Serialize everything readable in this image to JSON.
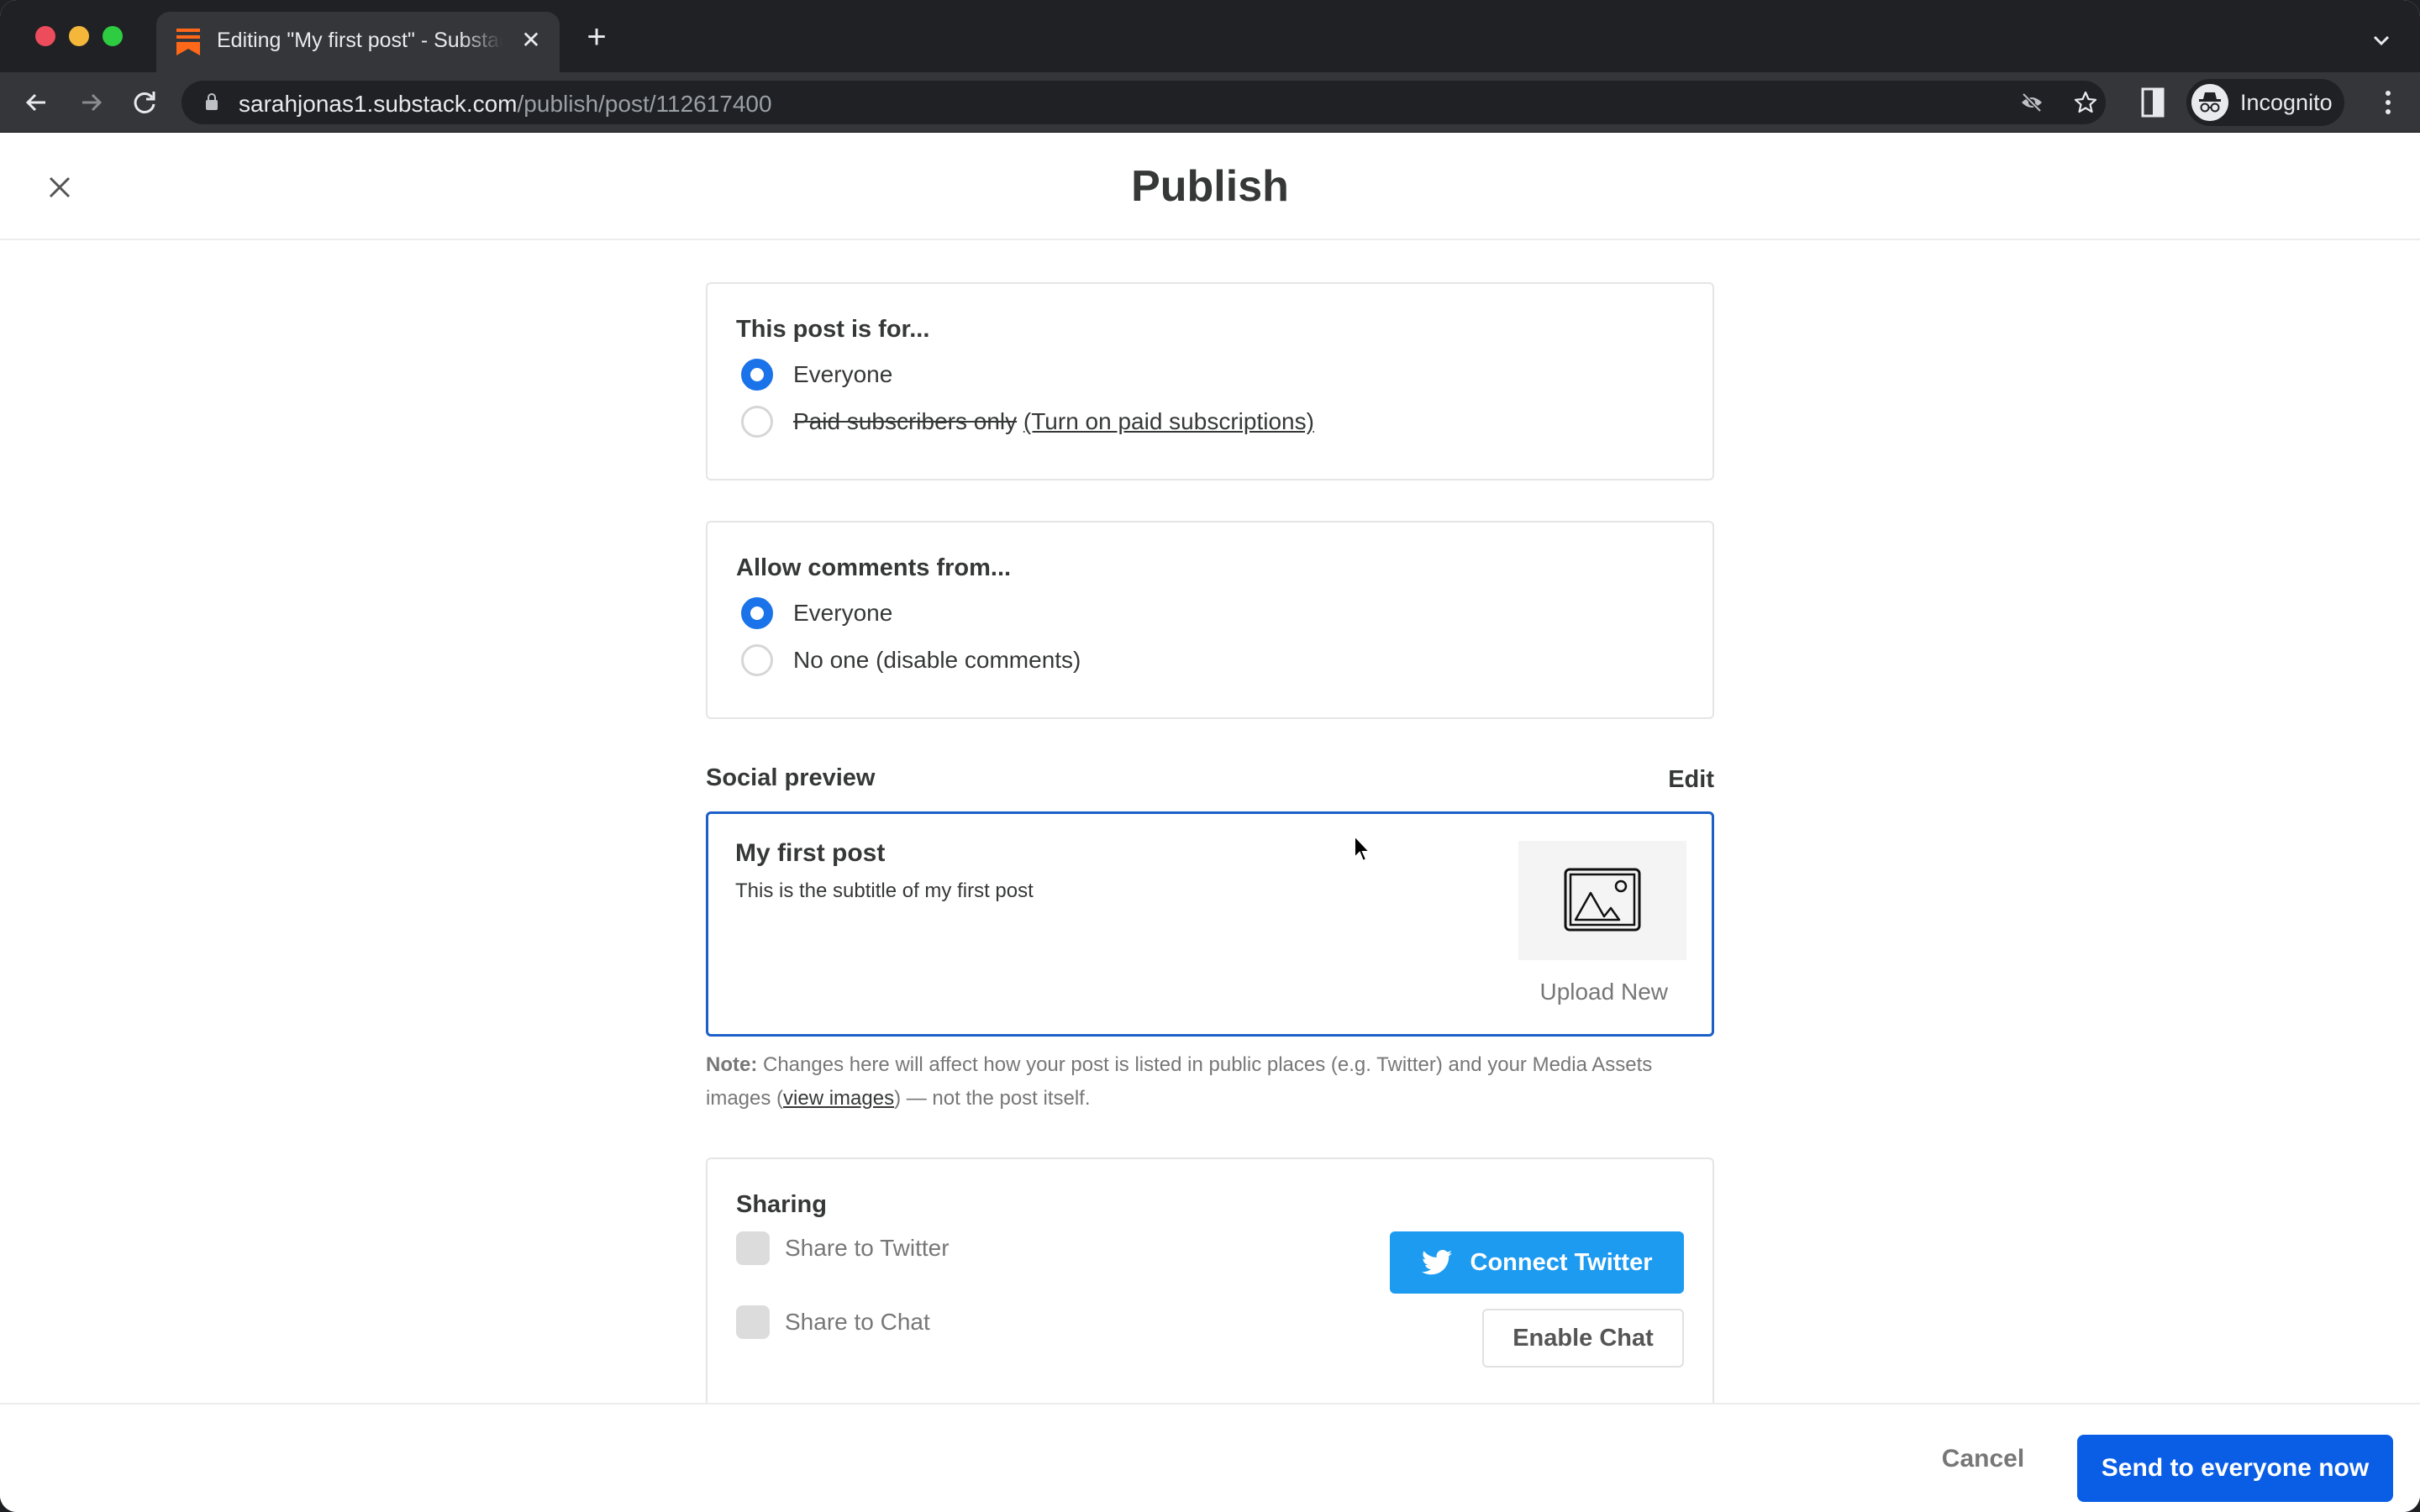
{
  "browser": {
    "tab_title": "Editing \"My first post\" - Substack",
    "url_host": "sarahjonas1.substack.com",
    "url_path": "/publish/post/112617400",
    "profile_label": "Incognito",
    "icons": {
      "back": "arrow-left-icon",
      "forward": "arrow-right-icon",
      "reload": "reload-icon",
      "lock": "lock-icon",
      "tracking": "eye-off-icon",
      "bookmark": "star-icon",
      "side_panel": "side-panel-icon",
      "profile": "incognito-icon",
      "menu": "kebab-menu-icon"
    }
  },
  "header": {
    "title": "Publish",
    "close_icon": "close-icon"
  },
  "audience": {
    "title": "This post is for...",
    "options": [
      {
        "label": "Everyone",
        "checked": true
      },
      {
        "label": "Paid subscribers only",
        "link": "(Turn on paid subscriptions)",
        "checked": false,
        "disabled": true
      }
    ]
  },
  "comments": {
    "title": "Allow comments from...",
    "options": [
      {
        "label": "Everyone",
        "checked": true
      },
      {
        "label": "No one (disable comments)",
        "checked": false
      }
    ]
  },
  "social_preview": {
    "label": "Social preview",
    "edit_label": "Edit",
    "post_title": "My first post",
    "post_subtitle": "This is the subtitle of my first post",
    "upload_label": "Upload New",
    "note_bold": "Note:",
    "note_text_1": " Changes here will affect how your post is listed in public places (e.g. Twitter) and your Media Assets images (",
    "note_link": "view images",
    "note_text_2": ") — not the post itself."
  },
  "sharing": {
    "title": "Sharing",
    "options": [
      {
        "label": "Share to Twitter",
        "checked": false
      },
      {
        "label": "Share to Chat",
        "checked": false
      }
    ],
    "connect_twitter_label": "Connect Twitter",
    "enable_chat_label": "Enable Chat"
  },
  "footer": {
    "cancel_label": "Cancel",
    "send_label": "Send to everyone now"
  },
  "colors": {
    "primary": "#0a5ee6",
    "radio_checked": "#1a73e8",
    "twitter": "#1d9bf0",
    "preview_border": "#1c5fc8",
    "substack_orange": "#ff6719"
  }
}
